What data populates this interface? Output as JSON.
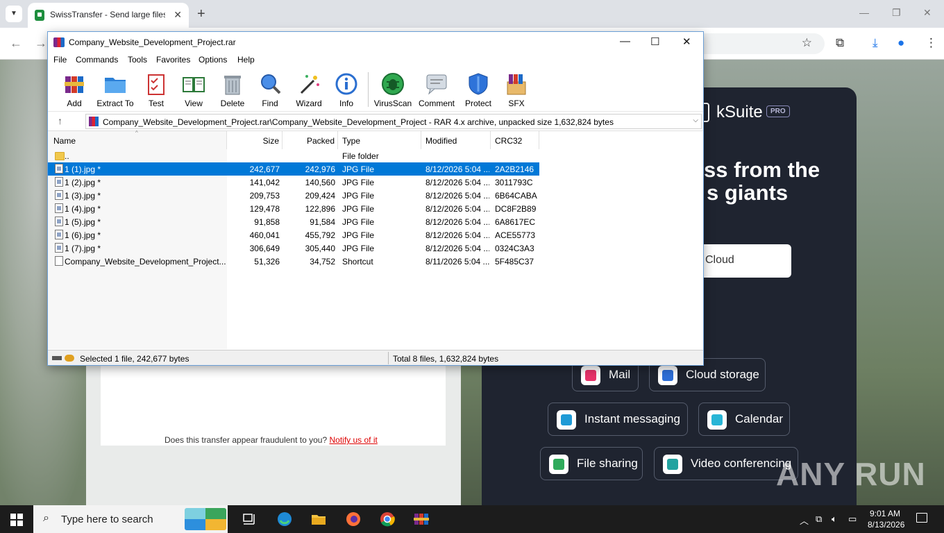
{
  "browser": {
    "tab_title": "SwissTransfer - Send large files",
    "tab_close": "✕",
    "new_tab": "+"
  },
  "webpage": {
    "brand": "kSuite",
    "pro_badge": "PRO",
    "headline_line1": "ss from the",
    "headline_line2": "s giants",
    "cloud_button": "Cloud",
    "features": [
      "Mail",
      "Cloud storage",
      "Instant messaging",
      "Calendar",
      "File sharing",
      "Video conferencing"
    ],
    "fraud_text": "Does this transfer appear fraudulent to you?",
    "fraud_link": "Notify us of it",
    "watermark": "ANY RUN"
  },
  "winrar": {
    "title": "Company_Website_Development_Project.rar",
    "menu": [
      "File",
      "Commands",
      "Tools",
      "Favorites",
      "Options",
      "Help"
    ],
    "toolbar": [
      "Add",
      "Extract To",
      "Test",
      "View",
      "Delete",
      "Find",
      "Wizard",
      "Info",
      "VirusScan",
      "Comment",
      "Protect",
      "SFX"
    ],
    "path": "Company_Website_Development_Project.rar\\Company_Website_Development_Project - RAR 4.x archive, unpacked size 1,632,824 bytes",
    "columns": [
      "Name",
      "Size",
      "Packed",
      "Type",
      "Modified",
      "CRC32"
    ],
    "rows": [
      {
        "name": "..",
        "size": "",
        "packed": "",
        "type": "File folder",
        "modified": "",
        "crc": ""
      },
      {
        "name": "1 (1).jpg *",
        "size": "242,677",
        "packed": "242,976",
        "type": "JPG File",
        "modified": "8/12/2026 5:04 ...",
        "crc": "2A2B2146"
      },
      {
        "name": "1 (2).jpg *",
        "size": "141,042",
        "packed": "140,560",
        "type": "JPG File",
        "modified": "8/12/2026 5:04 ...",
        "crc": "3011793C"
      },
      {
        "name": "1 (3).jpg *",
        "size": "209,753",
        "packed": "209,424",
        "type": "JPG File",
        "modified": "8/12/2026 5:04 ...",
        "crc": "6B64CABA"
      },
      {
        "name": "1 (4).jpg *",
        "size": "129,478",
        "packed": "122,896",
        "type": "JPG File",
        "modified": "8/12/2026 5:04 ...",
        "crc": "DC8F2B89"
      },
      {
        "name": "1 (5).jpg *",
        "size": "91,858",
        "packed": "91,584",
        "type": "JPG File",
        "modified": "8/12/2026 5:04 ...",
        "crc": "6A8617EC"
      },
      {
        "name": "1 (6).jpg *",
        "size": "460,041",
        "packed": "455,792",
        "type": "JPG File",
        "modified": "8/12/2026 5:04 ...",
        "crc": "ACE55773"
      },
      {
        "name": "1 (7).jpg *",
        "size": "306,649",
        "packed": "305,440",
        "type": "JPG File",
        "modified": "8/12/2026 5:04 ...",
        "crc": "0324C3A3"
      },
      {
        "name": "Company_Website_Development_Project....",
        "size": "51,326",
        "packed": "34,752",
        "type": "Shortcut",
        "modified": "8/11/2026 5:04 ...",
        "crc": "5F485C37"
      }
    ],
    "status_left": "Selected 1 file, 242,677 bytes",
    "status_right": "Total 8 files, 1,632,824 bytes"
  },
  "taskbar": {
    "search_placeholder": "Type here to search",
    "time": "9:01 AM",
    "date": "8/13/2026"
  }
}
